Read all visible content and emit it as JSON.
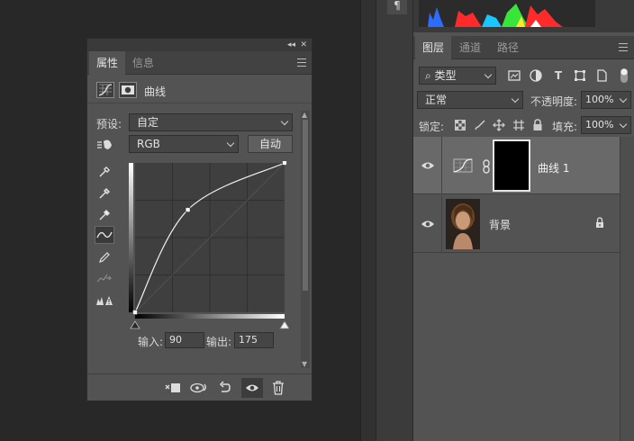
{
  "properties_panel": {
    "collapse_glyph": "◂◂",
    "close_glyph": "✕",
    "tabs": [
      "属性",
      "信息"
    ],
    "adjustment_title": "曲线",
    "preset_label": "预设:",
    "preset_value": "自定",
    "channel_value": "RGB",
    "auto_button": "自动",
    "input_label": "输入:",
    "input_value": "90",
    "output_label": "输出:",
    "output_value": "175"
  },
  "curve": {
    "x_range": [
      0,
      255
    ],
    "y_range": [
      0,
      255
    ],
    "points": [
      [
        0,
        0
      ],
      [
        90,
        175
      ],
      [
        255,
        255
      ]
    ]
  },
  "tools": [
    "eyedropper-black-icon",
    "eyedropper-gray-icon",
    "eyedropper-white-icon",
    "curve-point-icon",
    "pencil-icon",
    "smooth-icon",
    "clipping-warning-icon"
  ],
  "footer_icons": [
    "clip-to-layer-icon",
    "view-previous-icon",
    "reset-icon",
    "visibility-icon",
    "trash-icon"
  ],
  "layers_panel": {
    "paragraph_glyph": "¶",
    "tabs": [
      "图层",
      "通道",
      "路径"
    ],
    "filter_kind": "类型",
    "blend_mode": "正常",
    "opacity_label": "不透明度:",
    "opacity_value": "100%",
    "lock_label": "锁定:",
    "fill_label": "填充:",
    "fill_value": "100%",
    "layers": [
      {
        "name": "曲线 1",
        "selected": true
      },
      {
        "name": "背景",
        "selected": false
      }
    ]
  },
  "colors": {
    "panel_bg": "#535353",
    "app_bg": "#282828",
    "selected_layer": "#696969"
  }
}
